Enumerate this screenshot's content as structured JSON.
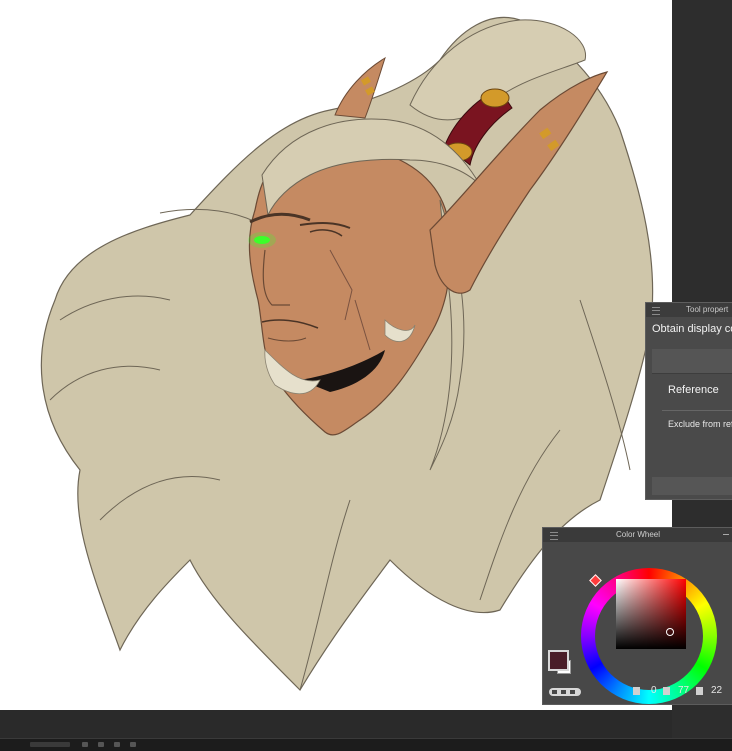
{
  "tool_property_panel": {
    "title": "Tool propert",
    "setting": "Obtain display co",
    "reference_label": "Reference",
    "exclude_label": "Exclude from refer"
  },
  "color_wheel_panel": {
    "title": "Color Wheel",
    "main_color": "#4a1e28",
    "sub_color": "#ffffff",
    "hue": "0",
    "saturation": "77",
    "value": "22"
  },
  "canvas": {
    "subject": "elf character portrait illustration",
    "hair_color": "#cfc6aa",
    "skin_color": "#c58a62",
    "eye_color": "#3dff2a"
  }
}
